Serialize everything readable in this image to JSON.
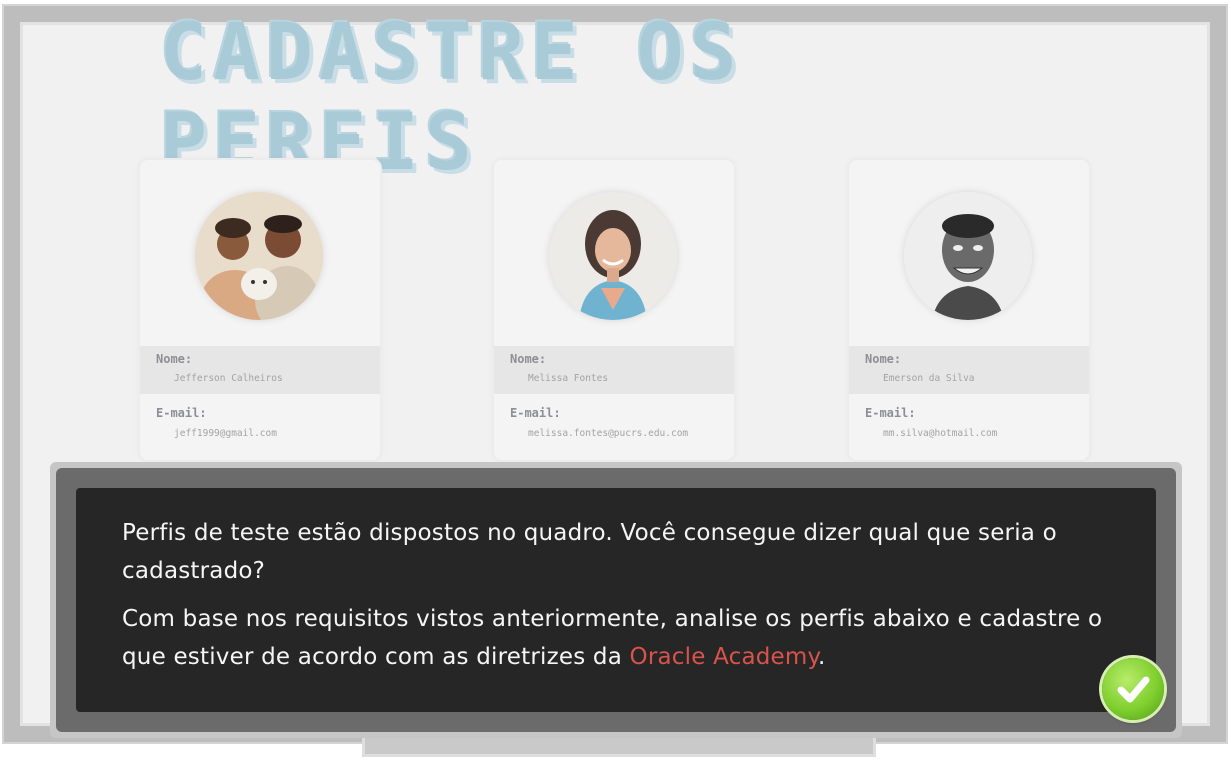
{
  "title": "Cadastre os perfis",
  "profiles": [
    {
      "name_label": "Nome:",
      "name": "Jefferson Calheiros",
      "email_label": "E-mail:",
      "email": "jeff1999@gmail.com",
      "avatar_icon": "couple-with-dog-photo"
    },
    {
      "name_label": "Nome:",
      "name": "Melissa Fontes",
      "email_label": "E-mail:",
      "email": "melissa.fontes@pucrs.edu.com",
      "avatar_icon": "woman-portrait-photo"
    },
    {
      "name_label": "Nome:",
      "name": "Emerson da Silva",
      "email_label": "E-mail:",
      "email": "mm.silva@hotmail.com",
      "avatar_icon": "man-portrait-drawing"
    }
  ],
  "dialog": {
    "paragraph1": "Perfis de teste estão dispostos no quadro. Você consegue dizer qual que seria o cadastrado?",
    "paragraph2_before": "Com base nos requisitos vistos anteriormente, analise os perfis abaixo e cadastre o que estiver de acordo com as diretrizes da ",
    "paragraph2_highlight": "Oracle Academy",
    "paragraph2_after": ".",
    "confirm_icon": "check-icon"
  },
  "colors": {
    "title": "#a9cbd8",
    "dialog_bg": "#262626",
    "highlight": "#d9534b",
    "confirm": "#7fcf2e"
  }
}
